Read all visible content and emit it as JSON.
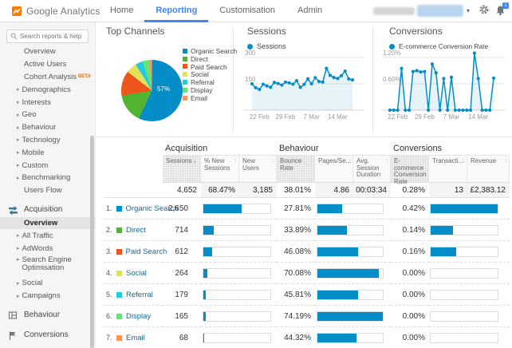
{
  "header": {
    "logo_text": "Google Analytics",
    "nav_items": [
      "Home",
      "Reporting",
      "Customisation",
      "Admin"
    ],
    "active_nav": "Reporting",
    "notification_count": "1"
  },
  "sidebar": {
    "search_placeholder": "Search reports & help",
    "items": [
      {
        "label": "Overview",
        "type": "item"
      },
      {
        "label": "Active Users",
        "type": "item"
      },
      {
        "label": "Cohort Analysis",
        "type": "item",
        "badge": "BETA"
      },
      {
        "label": "Demographics",
        "type": "sub"
      },
      {
        "label": "Interests",
        "type": "sub"
      },
      {
        "label": "Geo",
        "type": "sub"
      },
      {
        "label": "Behaviour",
        "type": "sub"
      },
      {
        "label": "Technology",
        "type": "sub"
      },
      {
        "label": "Mobile",
        "type": "sub"
      },
      {
        "label": "Custom",
        "type": "sub"
      },
      {
        "label": "Benchmarking",
        "type": "sub"
      },
      {
        "label": "Users Flow",
        "type": "item"
      },
      {
        "label": "Acquisition",
        "type": "section",
        "icon": "acquisition-icon"
      },
      {
        "label": "Overview",
        "type": "item",
        "selected": true
      },
      {
        "label": "All Traffic",
        "type": "sub"
      },
      {
        "label": "AdWords",
        "type": "sub"
      },
      {
        "label": "Search Engine Optimisation",
        "type": "sub"
      },
      {
        "label": "Social",
        "type": "sub"
      },
      {
        "label": "Campaigns",
        "type": "sub"
      },
      {
        "label": "Behaviour",
        "type": "section",
        "icon": "behaviour-icon"
      },
      {
        "label": "Conversions",
        "type": "section",
        "icon": "conversions-icon"
      }
    ]
  },
  "panels": {
    "top_channels_title": "Top Channels",
    "sessions_title": "Sessions",
    "sessions_legend": "Sessions",
    "conversions_title": "Conversions",
    "conversions_legend": "E-commerce Conversion Rate"
  },
  "chart_data": [
    {
      "type": "pie",
      "title": "Top Channels",
      "categories": [
        "Organic Search",
        "Direct",
        "Paid Search",
        "Social",
        "Referral",
        "Display",
        "Email"
      ],
      "values": [
        2650,
        714,
        612,
        264,
        179,
        165,
        68
      ],
      "colors": [
        "#058dc7",
        "#50b432",
        "#ed561b",
        "#e2e258",
        "#24cbe5",
        "#64e572",
        "#ff9655"
      ],
      "slice_label": "57%",
      "legend_position": "right"
    },
    {
      "type": "line",
      "title": "Sessions",
      "series": [
        {
          "name": "Sessions",
          "values": [
            150,
            128,
            118,
            148,
            138,
            130,
            158,
            152,
            143,
            160,
            155,
            148,
            168,
            130,
            147,
            178,
            150,
            185,
            163,
            160,
            238,
            198,
            186,
            180,
            196,
            222,
            178,
            172
          ]
        }
      ],
      "x_tick_labels": [
        "22 Feb",
        "29 Feb",
        "7 Mar",
        "14 Mar"
      ],
      "x_tick_indices": [
        2,
        9,
        16,
        23
      ],
      "ylim": [
        0,
        300
      ],
      "yticks": [
        {
          "value": 300,
          "label": "300"
        },
        {
          "value": 150,
          "label": "150"
        }
      ],
      "color": "#058dc7",
      "area_fill": true
    },
    {
      "type": "line",
      "title": "Conversions",
      "series": [
        {
          "name": "E-commerce Conversion Rate",
          "values": [
            0,
            0,
            0,
            0.95,
            0,
            0,
            0.88,
            0.9,
            0.87,
            0.88,
            0,
            1.05,
            0.85,
            0,
            0.72,
            0,
            0.75,
            0,
            0,
            0,
            0,
            0,
            1.3,
            0.72,
            0,
            0,
            0,
            0.73
          ]
        }
      ],
      "x_tick_labels": [
        "22 Feb",
        "29 Feb",
        "7 Mar",
        "14 Mar"
      ],
      "x_tick_indices": [
        2,
        9,
        16,
        23
      ],
      "ylim": [
        0,
        1.32
      ],
      "yticks": [
        {
          "value": 1.2,
          "label": "1.20%"
        },
        {
          "value": 0.6,
          "label": "0.60%"
        }
      ],
      "color": "#058dc7",
      "area_fill": true
    }
  ],
  "table": {
    "group_headers": [
      "Acquisition",
      "Behaviour",
      "Conversions"
    ],
    "columns": [
      "Sessions",
      "% New Sessions",
      "New Users",
      "Bounce Rate",
      "Pages/Se...",
      "Avg. Session Duration",
      "E-commerce Conversion Rate",
      "Transacti...",
      "Revenue"
    ],
    "sorted_column": "Sessions",
    "totals": [
      "4,652",
      "68.47%",
      "3,185",
      "38.01%",
      "4.86",
      "00:03:34",
      "0.28%",
      "13",
      "£2,383.12"
    ],
    "sessions_total": 4652,
    "max_bounce": 74.19,
    "max_conv": 0.42,
    "rows": [
      {
        "rank": "1",
        "channel": "Organic Search",
        "color": "#058dc7",
        "sessions": "2,650",
        "sessions_num": 2650,
        "bounce": "27.81%",
        "bounce_num": 27.81,
        "conv": "0.42%",
        "conv_num": 0.42
      },
      {
        "rank": "2",
        "channel": "Direct",
        "color": "#50b432",
        "sessions": "714",
        "sessions_num": 714,
        "bounce": "33.89%",
        "bounce_num": 33.89,
        "conv": "0.14%",
        "conv_num": 0.14
      },
      {
        "rank": "3",
        "channel": "Paid Search",
        "color": "#ed561b",
        "sessions": "612",
        "sessions_num": 612,
        "bounce": "46.08%",
        "bounce_num": 46.08,
        "conv": "0.16%",
        "conv_num": 0.16
      },
      {
        "rank": "4",
        "channel": "Social",
        "color": "#e2e258",
        "sessions": "264",
        "sessions_num": 264,
        "bounce": "70.08%",
        "bounce_num": 70.08,
        "conv": "0.00%",
        "conv_num": 0
      },
      {
        "rank": "5",
        "channel": "Referral",
        "color": "#24cbe5",
        "sessions": "179",
        "sessions_num": 179,
        "bounce": "45.81%",
        "bounce_num": 45.81,
        "conv": "0.00%",
        "conv_num": 0
      },
      {
        "rank": "6",
        "channel": "Display",
        "color": "#64e572",
        "sessions": "165",
        "sessions_num": 165,
        "bounce": "74.19%",
        "bounce_num": 74.19,
        "conv": "0.00%",
        "conv_num": 0
      },
      {
        "rank": "7",
        "channel": "Email",
        "color": "#ff9655",
        "sessions": "68",
        "sessions_num": 68,
        "bounce": "44.32%",
        "bounce_num": 44.32,
        "conv": "0.00%",
        "conv_num": 0
      }
    ]
  }
}
